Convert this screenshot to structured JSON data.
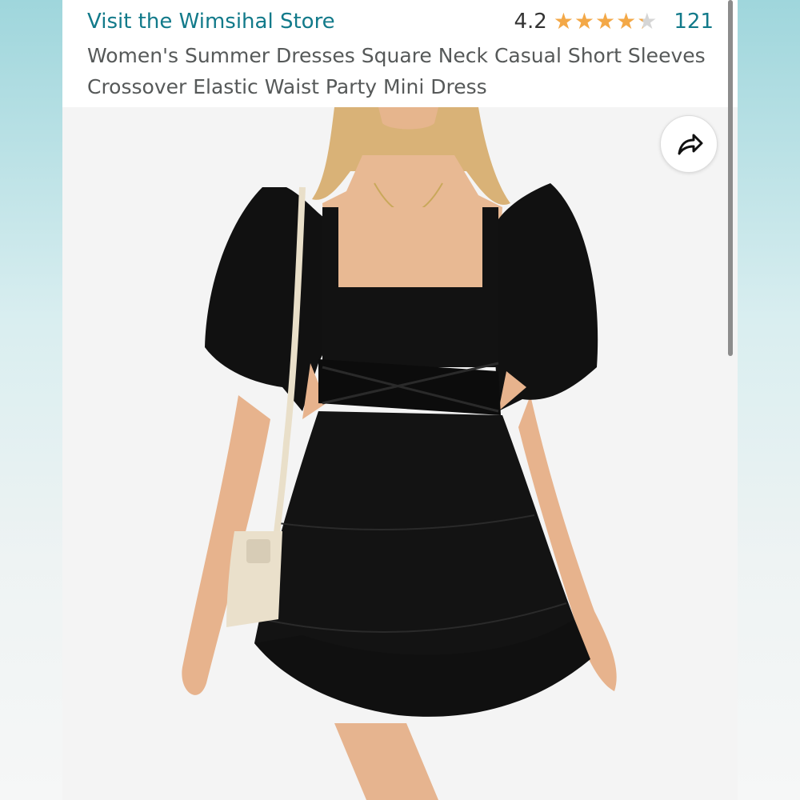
{
  "header": {
    "store_link": "Visit the Wimsihal Store",
    "rating_value": "4.2",
    "rating_fraction": 0.84,
    "review_count": "121",
    "title": "Women's Summer Dresses Square Neck Casual Short Sleeves Crossover Elastic Waist Party Mini Dress"
  },
  "image": {
    "alt": "Woman wearing black short-sleeve tiered mini dress with crossover elastic waist and cream shoulder bag"
  },
  "icons": {
    "share": "share-arrow-icon",
    "star": "star-icon"
  },
  "colors": {
    "link": "#127a8a",
    "star": "#f3a847",
    "title_text": "#565959"
  }
}
